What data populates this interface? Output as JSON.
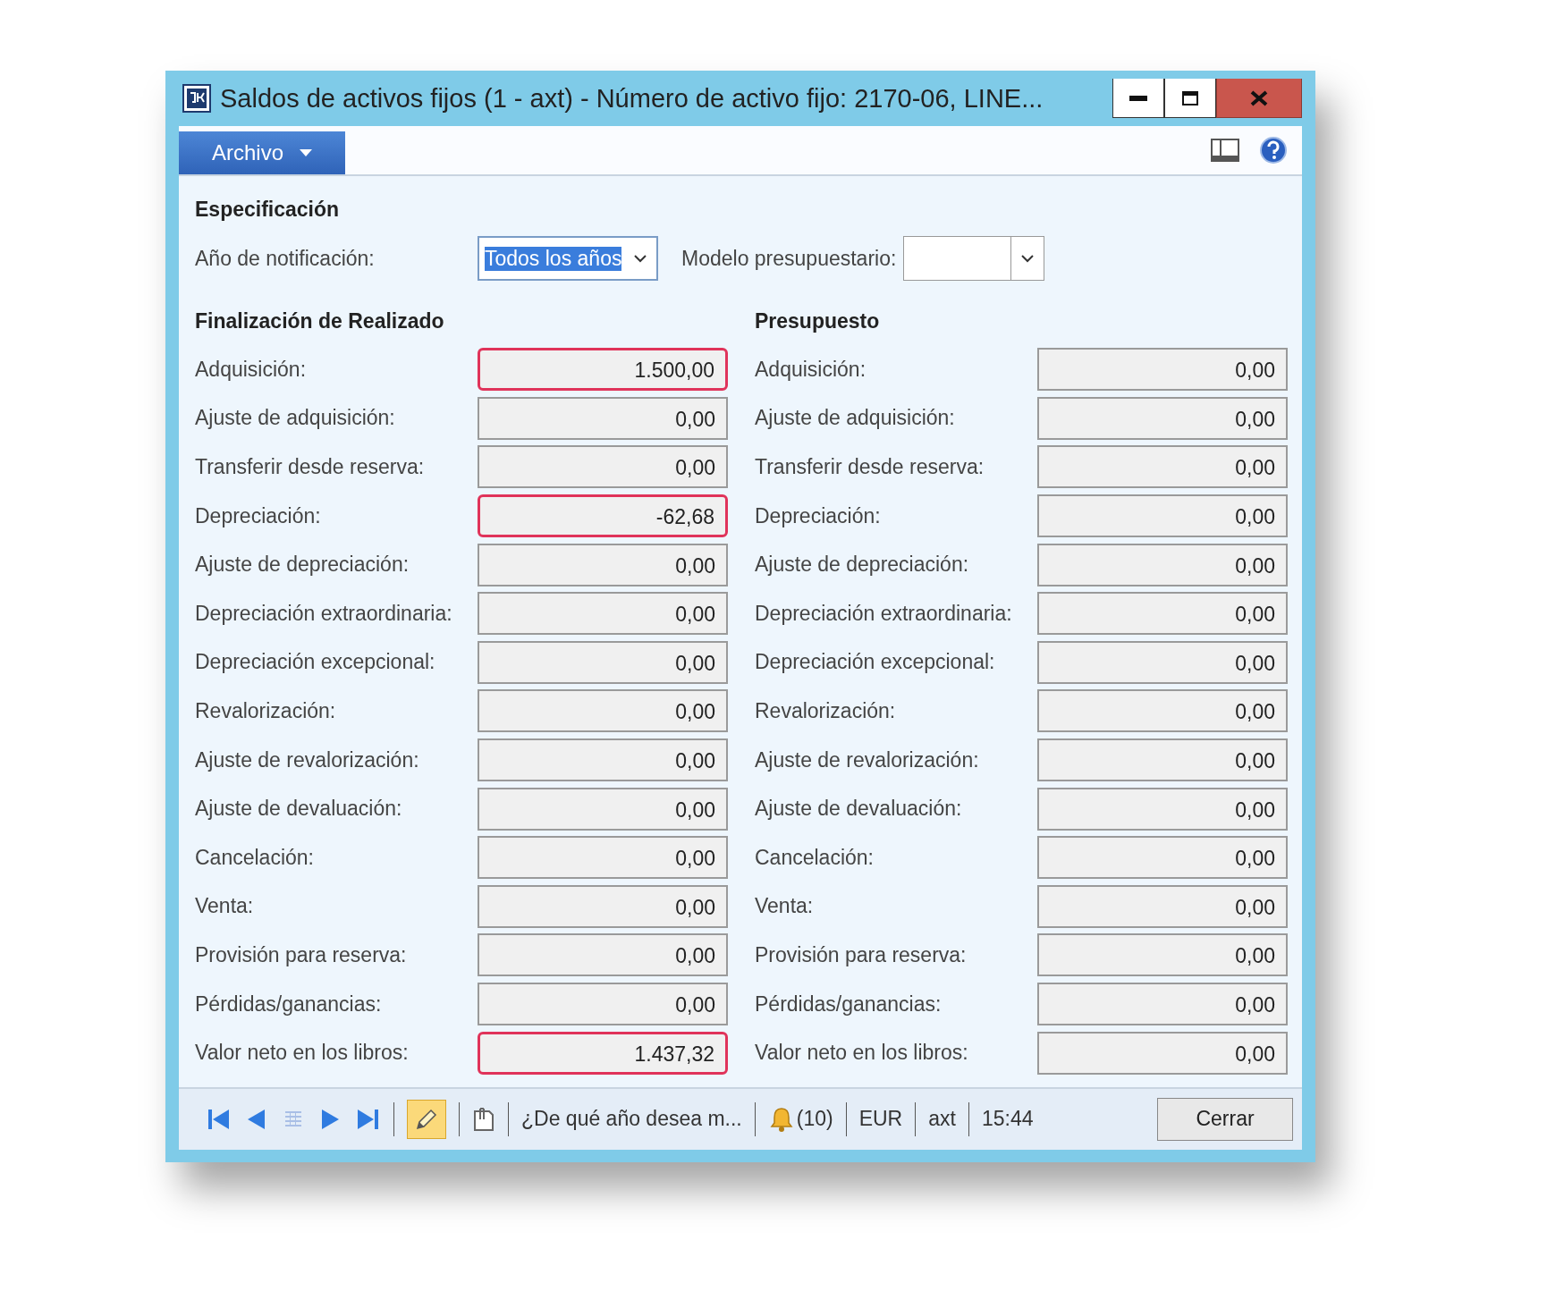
{
  "window": {
    "title": "Saldos de activos fijos (1 - axt) - Número de activo fijo: 2170-06, LINE..."
  },
  "menu": {
    "label": "Archivo"
  },
  "specification": {
    "heading": "Especificación",
    "fields": [
      {
        "label": "Año de notificación:",
        "value": "Todos los años",
        "text_selected": true
      },
      {
        "label": "Modelo presupuestario:"
      }
    ]
  },
  "sections": [
    {
      "heading": "Finalización de Realizado",
      "rows": [
        {
          "label": "Adquisición:",
          "value": "1.500,00",
          "highlighted": true
        },
        {
          "label": "Ajuste de adquisición:",
          "value": "0,00",
          "highlighted": false
        },
        {
          "label": "Transferir desde reserva:",
          "value": "0,00",
          "highlighted": false
        },
        {
          "label": "Depreciación:",
          "value": "-62,68",
          "highlighted": true
        },
        {
          "label": "Ajuste de depreciación:",
          "value": "0,00",
          "highlighted": false
        },
        {
          "label": "Depreciación extraordinaria:",
          "value": "0,00",
          "highlighted": false
        },
        {
          "label": "Depreciación excepcional:",
          "value": "0,00",
          "highlighted": false
        },
        {
          "label": "Revalorización:",
          "value": "0,00",
          "highlighted": false
        },
        {
          "label": "Ajuste de revalorización:",
          "value": "0,00",
          "highlighted": false
        },
        {
          "label": "Ajuste de devaluación:",
          "value": "0,00",
          "highlighted": false
        },
        {
          "label": "Cancelación:",
          "value": "0,00",
          "highlighted": false
        },
        {
          "label": "Venta:",
          "value": "0,00",
          "highlighted": false
        },
        {
          "label": "Provisión para reserva:",
          "value": "0,00",
          "highlighted": false
        },
        {
          "label": "Pérdidas/ganancias:",
          "value": "0,00",
          "highlighted": false
        },
        {
          "label": "Valor neto en los libros:",
          "value": "1.437,32",
          "highlighted": true
        }
      ]
    },
    {
      "heading": "Presupuesto",
      "rows": [
        {
          "label": "Adquisición:",
          "value": "0,00",
          "highlighted": false
        },
        {
          "label": "Ajuste de adquisición:",
          "value": "0,00",
          "highlighted": false
        },
        {
          "label": "Transferir desde reserva:",
          "value": "0,00",
          "highlighted": false
        },
        {
          "label": "Depreciación:",
          "value": "0,00",
          "highlighted": false
        },
        {
          "label": "Ajuste de depreciación:",
          "value": "0,00",
          "highlighted": false
        },
        {
          "label": "Depreciación extraordinaria:",
          "value": "0,00",
          "highlighted": false
        },
        {
          "label": "Depreciación excepcional:",
          "value": "0,00",
          "highlighted": false
        },
        {
          "label": "Revalorización:",
          "value": "0,00",
          "highlighted": false
        },
        {
          "label": "Ajuste de revalorización:",
          "value": "0,00",
          "highlighted": false
        },
        {
          "label": "Ajuste de devaluación:",
          "value": "0,00",
          "highlighted": false
        },
        {
          "label": "Cancelación:",
          "value": "0,00",
          "highlighted": false
        },
        {
          "label": "Venta:",
          "value": "0,00",
          "highlighted": false
        },
        {
          "label": "Provisión para reserva:",
          "value": "0,00",
          "highlighted": false
        },
        {
          "label": "Pérdidas/ganancias:",
          "value": "0,00",
          "highlighted": false
        },
        {
          "label": "Valor neto en los libros:",
          "value": "0,00",
          "highlighted": false
        }
      ]
    }
  ],
  "status_bar": {
    "edit_mode": true,
    "message": "¿De qué año desea m...",
    "notifications": "(10)",
    "currency": "EUR",
    "company": "axt",
    "time": "15:44",
    "close_button": "Cerrar"
  }
}
